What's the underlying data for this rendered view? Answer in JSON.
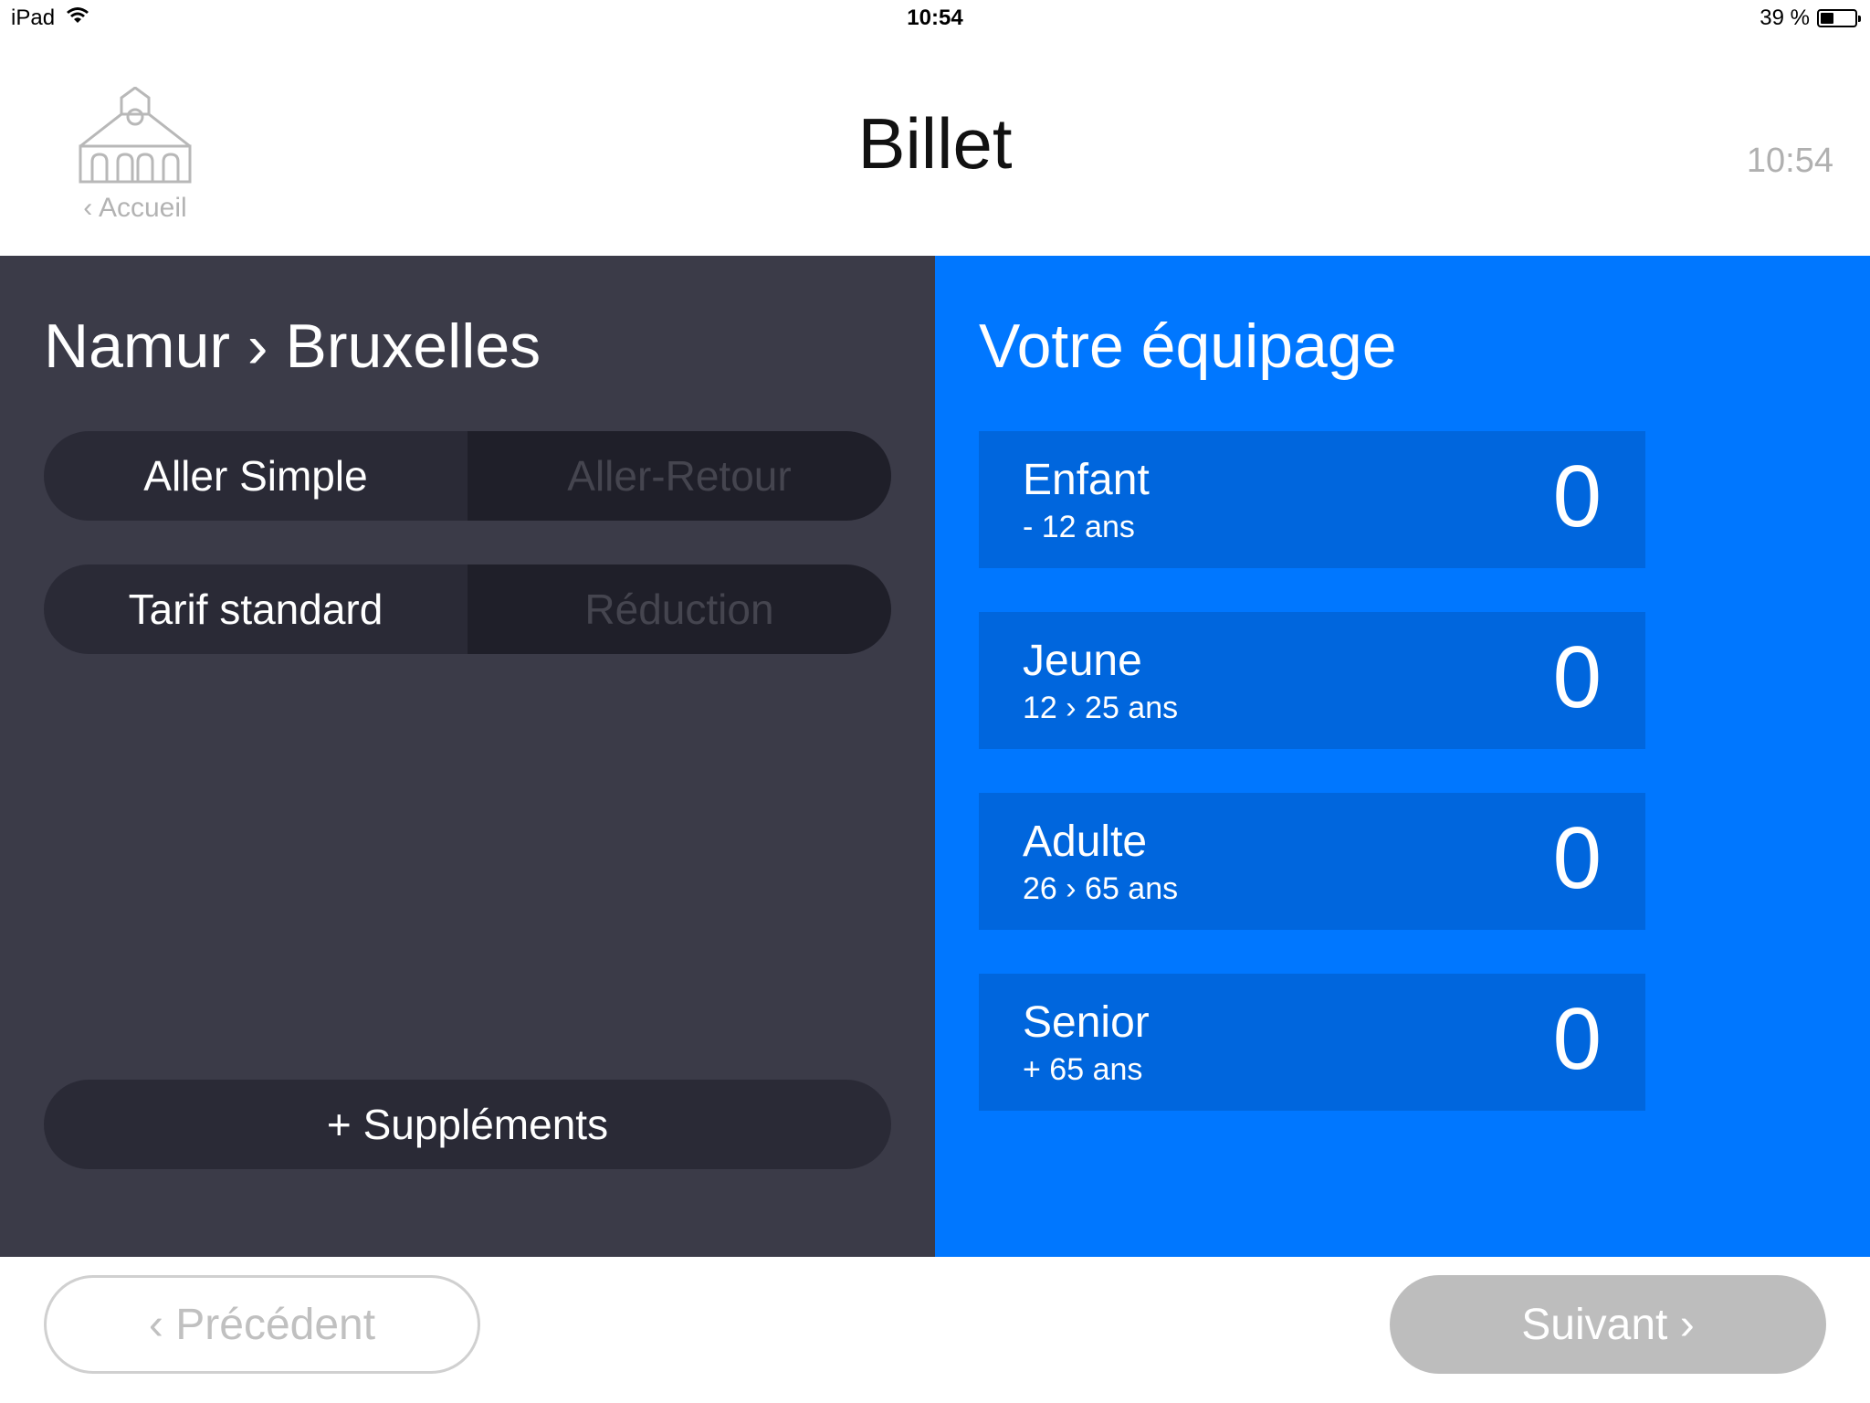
{
  "status_bar": {
    "device": "iPad",
    "time": "10:54",
    "battery_text": "39 %",
    "battery_level": 0.39
  },
  "header": {
    "home_label": "‹ Accueil",
    "title": "Billet",
    "time": "10:54"
  },
  "route": {
    "title": "Namur › Bruxelles"
  },
  "trip_type": {
    "options": [
      "Aller Simple",
      "Aller-Retour"
    ],
    "selected": "Aller Simple"
  },
  "fare_type": {
    "options": [
      "Tarif standard",
      "Réduction"
    ],
    "selected": "Tarif standard"
  },
  "supplements_label": "+ Suppléments",
  "crew": {
    "title": "Votre équipage",
    "passengers": [
      {
        "name": "Enfant",
        "age": "- 12 ans",
        "count": "0"
      },
      {
        "name": "Jeune",
        "age": "12 › 25 ans",
        "count": "0"
      },
      {
        "name": "Adulte",
        "age": "26 › 65 ans",
        "count": "0"
      },
      {
        "name": "Senior",
        "age": "+ 65 ans",
        "count": "0"
      }
    ]
  },
  "nav": {
    "prev_label": "‹ Précédent",
    "next_label": "Suivant ›"
  },
  "colors": {
    "left_panel": "#3b3b48",
    "right_panel": "#0077ff",
    "passenger_card": "#0066dd",
    "next_button": "#bdbdbd"
  },
  "icons": {
    "home": "building-icon",
    "wifi": "wifi-icon",
    "battery": "battery-icon"
  }
}
